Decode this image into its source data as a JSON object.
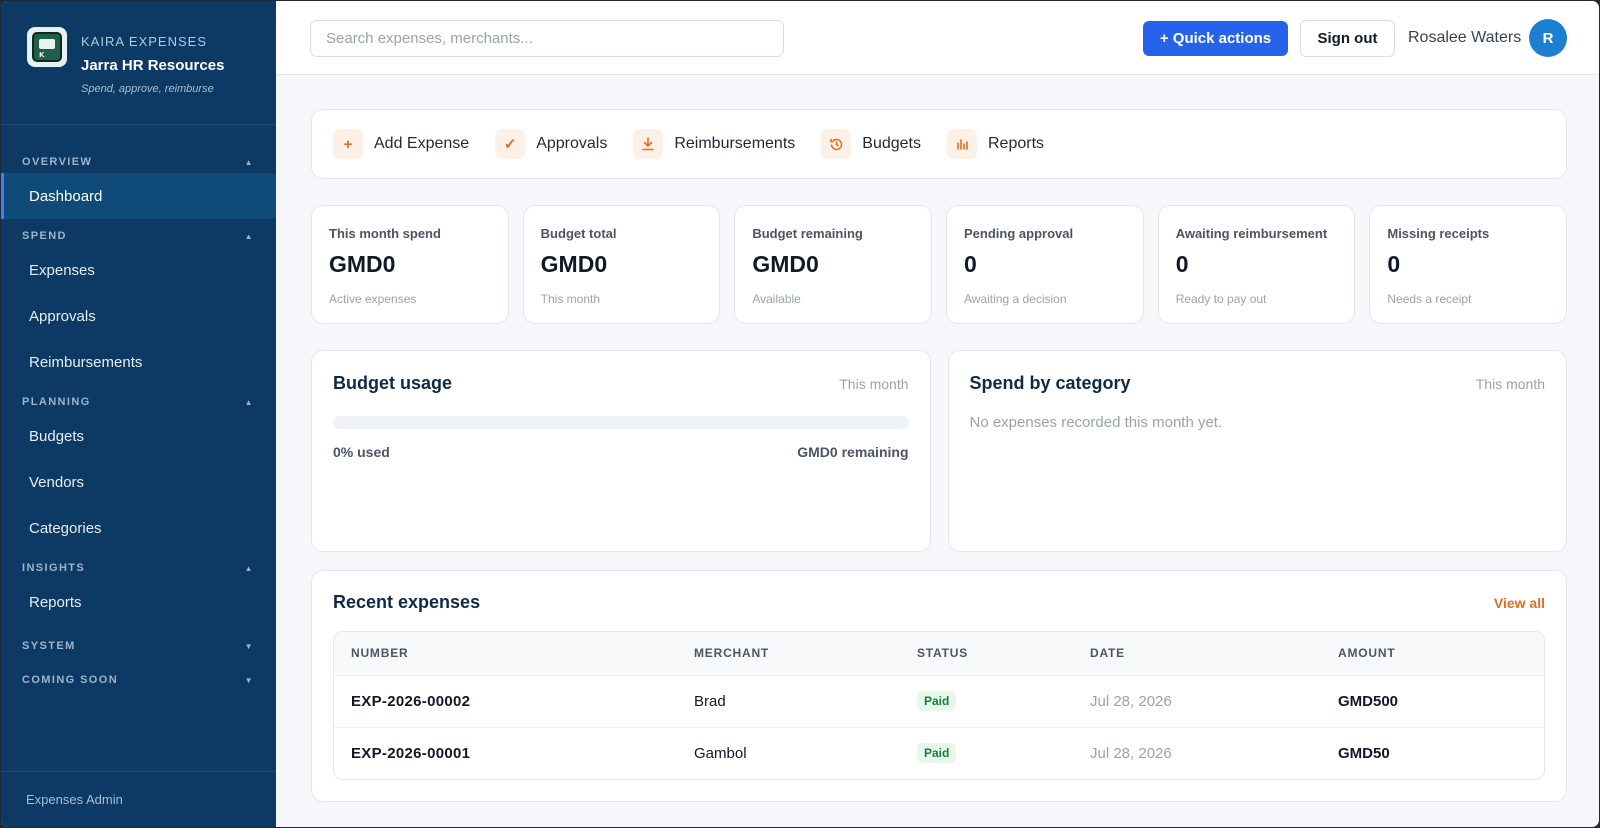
{
  "sidebar": {
    "kicker": "KAIRA EXPENSES",
    "org_name": "Jarra HR Resources",
    "tagline": "Spend, approve, reimburse",
    "sections": [
      {
        "title": "OVERVIEW",
        "items": [
          "Dashboard"
        ]
      },
      {
        "title": "SPEND",
        "items": [
          "Expenses",
          "Approvals",
          "Reimbursements"
        ]
      },
      {
        "title": "PLANNING",
        "items": [
          "Budgets",
          "Vendors",
          "Categories"
        ]
      },
      {
        "title": "INSIGHTS",
        "items": [
          "Reports"
        ]
      },
      {
        "title": "SYSTEM",
        "items": []
      },
      {
        "title": "COMING SOON",
        "items": []
      }
    ],
    "active_item": "Dashboard",
    "footer": "Expenses Admin"
  },
  "topbar": {
    "search_placeholder": "Search expenses, merchants...",
    "quick_actions_label": "+ Quick actions",
    "sign_out_label": "Sign out",
    "user_name": "Rosalee Waters",
    "avatar_initial": "R"
  },
  "quick_links": [
    "Add Expense",
    "Approvals",
    "Reimbursements",
    "Budgets",
    "Reports"
  ],
  "stats": [
    {
      "label": "This month spend",
      "value": "GMD0",
      "sub": "Active expenses"
    },
    {
      "label": "Budget total",
      "value": "GMD0",
      "sub": "This month"
    },
    {
      "label": "Budget remaining",
      "value": "GMD0",
      "sub": "Available"
    },
    {
      "label": "Pending approval",
      "value": "0",
      "sub": "Awaiting a decision"
    },
    {
      "label": "Awaiting reimbursement",
      "value": "0",
      "sub": "Ready to pay out"
    },
    {
      "label": "Missing receipts",
      "value": "0",
      "sub": "Needs a receipt"
    }
  ],
  "budget_usage": {
    "title": "Budget usage",
    "period": "This month",
    "used_fraction": 0,
    "used_label": "0% used",
    "remaining_label": "GMD0 remaining"
  },
  "spend_by_category": {
    "title": "Spend by category",
    "period": "This month",
    "empty_text": "No expenses recorded this month yet."
  },
  "recent": {
    "title": "Recent expenses",
    "view_all": "View all",
    "columns": [
      "NUMBER",
      "MERCHANT",
      "STATUS",
      "DATE",
      "AMOUNT"
    ],
    "rows": [
      {
        "number": "EXP-2026-00002",
        "merchant": "Brad",
        "status": "Paid",
        "date": "Jul 28, 2026",
        "amount": "GMD500"
      },
      {
        "number": "EXP-2026-00001",
        "merchant": "Gambol",
        "status": "Paid",
        "date": "Jul 28, 2026",
        "amount": "GMD50"
      }
    ]
  }
}
